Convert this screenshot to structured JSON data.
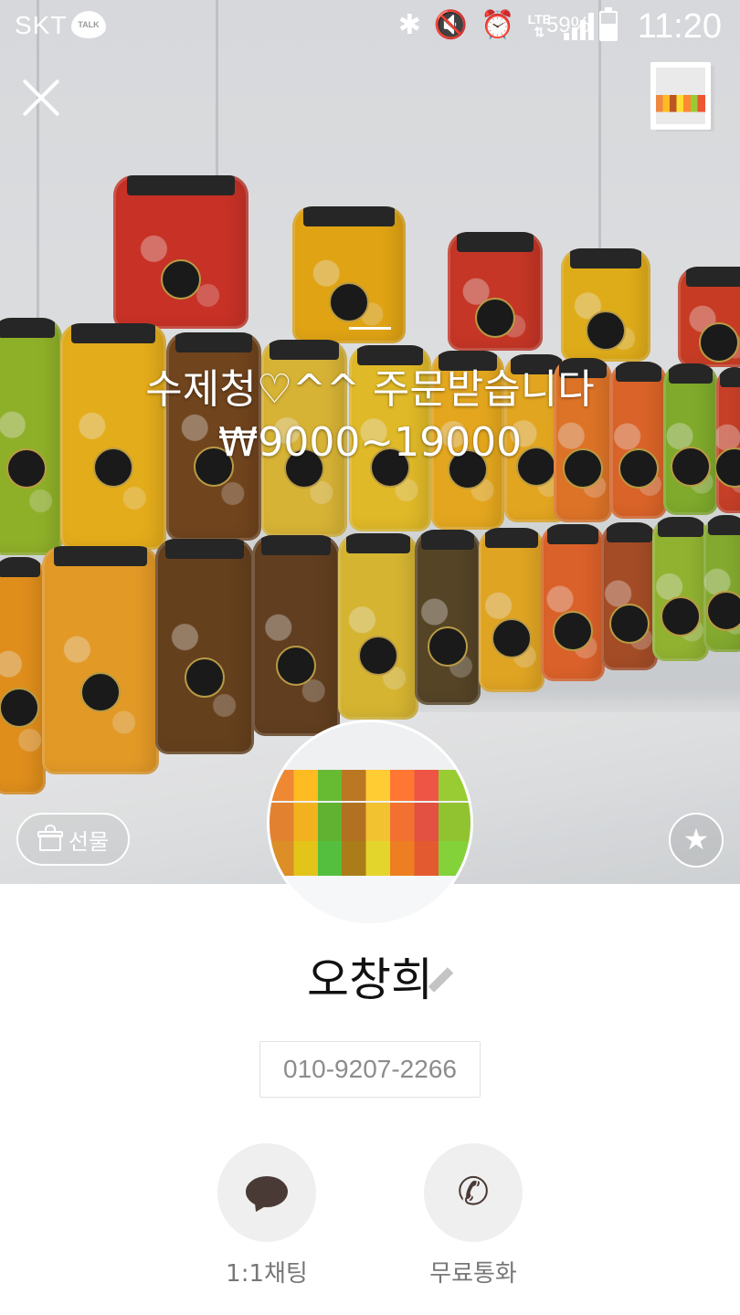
{
  "status_bar": {
    "carrier": "SKT",
    "talk_badge": "TALK",
    "network": "LTE",
    "battery_percent": "59%",
    "battery_level": 0.59,
    "time": "11:20",
    "icons": [
      "bluetooth-icon",
      "mute-icon",
      "alarm-icon",
      "lte-icon",
      "signal-icon",
      "battery-icon"
    ]
  },
  "cover": {
    "status_message_line1": "수제청♡^^ 주문받습니다",
    "status_message_line2": "₩9000~19000"
  },
  "actions": {
    "gift_label": "선물"
  },
  "profile": {
    "name": "오창희",
    "phone": "010-9207-2266"
  },
  "buttons": {
    "chat_label": "1:1채팅",
    "call_label": "무료통화"
  },
  "colors": {
    "overlay_text": "#ffffff",
    "action_icon": "#4a3a36",
    "action_circle": "#efefef",
    "label_gray": "#777777"
  }
}
